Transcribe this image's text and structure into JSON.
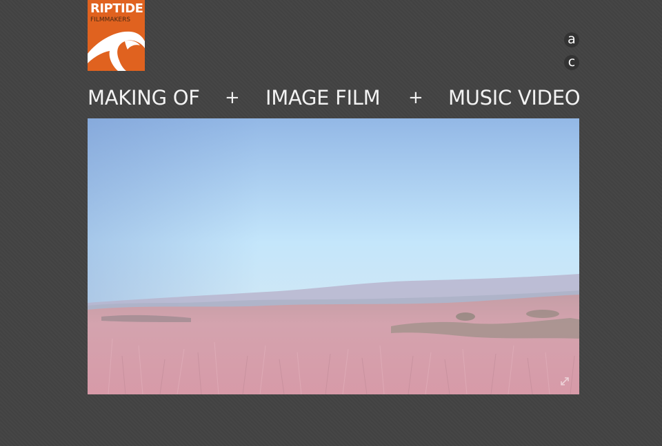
{
  "logo": {
    "title": "RIPTIDE",
    "subtitle": "FILMMAKERS",
    "color": "#e0621f"
  },
  "language": {
    "items": [
      "a",
      "c"
    ]
  },
  "nav": {
    "items": [
      "MAKING OF",
      "IMAGE FILM",
      "MUSIC VIDEO"
    ],
    "separator": "+"
  },
  "video": {
    "description_icon": "expand-icon"
  }
}
